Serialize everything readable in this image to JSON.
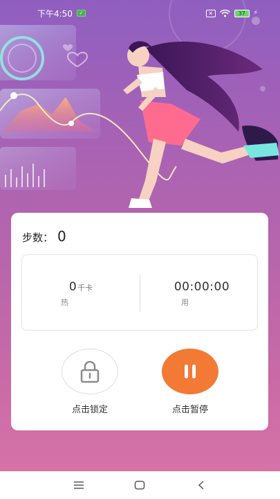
{
  "status_bar": {
    "time": "下午4:50",
    "battery": "37"
  },
  "steps": {
    "label": "步数：",
    "value": "0"
  },
  "stats": {
    "calories": {
      "value": "0",
      "unit": "千卡",
      "caption": "热"
    },
    "duration": {
      "value": "00:00:00",
      "caption": "用"
    }
  },
  "actions": {
    "lock_label": "点击锁定",
    "pause_label": "点击暂停"
  },
  "colors": {
    "accent": "#f27a35",
    "background_top": "#8f5fc0",
    "background_bottom": "#d672a8"
  },
  "icons": {
    "lock": "lock-icon",
    "pause": "pause-icon",
    "menu": "menu-icon",
    "home": "home-icon",
    "back": "back-icon"
  }
}
